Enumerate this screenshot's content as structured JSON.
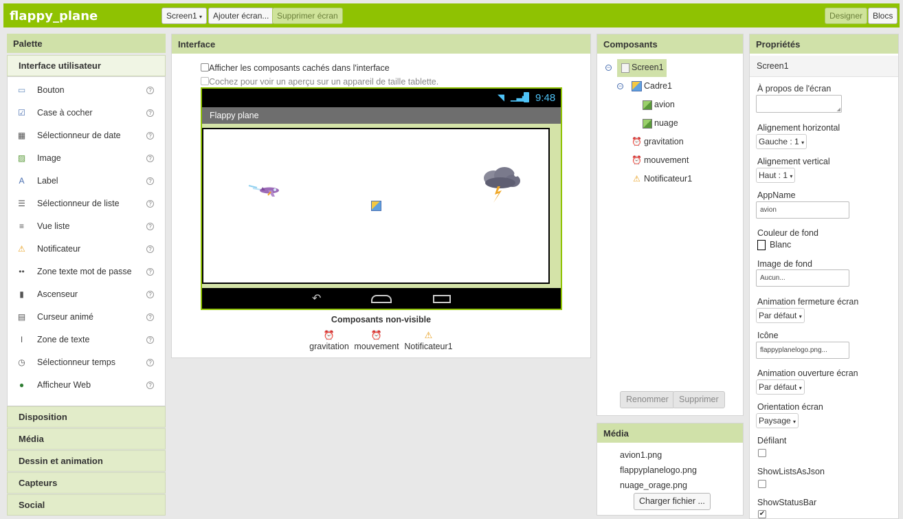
{
  "app": {
    "title": "flappy_plane"
  },
  "toolbar": {
    "screen_select": "Screen1",
    "add_screen": "Ajouter écran...",
    "remove_screen": "Supprimer écran",
    "designer": "Designer",
    "blocks": "Blocs"
  },
  "palette": {
    "title": "Palette",
    "active_category": "Interface utilisateur",
    "items": [
      {
        "label": "Bouton",
        "icon": "button-icon"
      },
      {
        "label": "Case à cocher",
        "icon": "checkbox-icon"
      },
      {
        "label": "Sélectionneur de date",
        "icon": "datepicker-icon"
      },
      {
        "label": "Image",
        "icon": "image-icon"
      },
      {
        "label": "Label",
        "icon": "label-icon"
      },
      {
        "label": "Sélectionneur de liste",
        "icon": "listpicker-icon"
      },
      {
        "label": "Vue liste",
        "icon": "listview-icon"
      },
      {
        "label": "Notificateur",
        "icon": "notifier-icon"
      },
      {
        "label": "Zone texte mot de passe",
        "icon": "password-icon"
      },
      {
        "label": "Ascenseur",
        "icon": "slider-icon"
      },
      {
        "label": "Curseur animé",
        "icon": "spinner-icon"
      },
      {
        "label": "Zone de texte",
        "icon": "textbox-icon"
      },
      {
        "label": "Sélectionneur temps",
        "icon": "timepicker-icon"
      },
      {
        "label": "Afficheur Web",
        "icon": "webviewer-icon"
      }
    ],
    "help_glyph": "?",
    "categories": [
      "Disposition",
      "Média",
      "Dessin et animation",
      "Capteurs",
      "Social"
    ]
  },
  "viewer": {
    "title": "Interface",
    "show_hidden": "Afficher les composants cachés dans l'interface",
    "tablet_preview": "Cochez pour voir un aperçu sur un appareil de taille tablette.",
    "status_time": "9:48",
    "screen_title": "Flappy plane",
    "non_visible_title": "Composants non-visible",
    "non_visible": [
      "gravitation",
      "mouvement",
      "Notificateur1"
    ]
  },
  "components": {
    "title": "Composants",
    "tree": [
      "Screen1",
      "Cadre1",
      "avion",
      "nuage",
      "gravitation",
      "mouvement",
      "Notificateur1"
    ],
    "rename": "Renommer",
    "delete": "Supprimer"
  },
  "media": {
    "title": "Média",
    "files": [
      "avion1.png",
      "flappyplanelogo.png",
      "nuage_orage.png"
    ],
    "upload": "Charger fichier ..."
  },
  "properties": {
    "title": "Propriétés",
    "component": "Screen1",
    "about_label": "À propos de l'écran",
    "h_align_label": "Alignement horizontal",
    "h_align_value": "Gauche : 1",
    "v_align_label": "Alignement vertical",
    "v_align_value": "Haut : 1",
    "appname_label": "AppName",
    "appname_value": "avion",
    "bg_color_label": "Couleur de fond",
    "bg_color_value": "Blanc",
    "bg_image_label": "Image de fond",
    "bg_image_value": "Aucun...",
    "close_anim_label": "Animation fermeture écran",
    "close_anim_value": "Par défaut",
    "icon_label": "Icône",
    "icon_value": "flappyplanelogo.png...",
    "open_anim_label": "Animation ouverture écran",
    "open_anim_value": "Par défaut",
    "orientation_label": "Orientation écran",
    "orientation_value": "Paysage",
    "scrollable_label": "Défilant",
    "scrollable_checked": false,
    "showlists_label": "ShowListsAsJson",
    "showlists_checked": false,
    "statusbar_label": "ShowStatusBar",
    "statusbar_checked": true
  },
  "colors": {
    "brand": "#8fc202",
    "header": "#d0e1a9",
    "phone_bar": "#000000",
    "title_bar": "#6e6e6e"
  }
}
